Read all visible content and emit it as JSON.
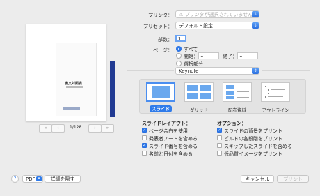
{
  "printer": {
    "label": "プリンタ：",
    "value": "プリンタが選択されていません",
    "icon": "warning-icon"
  },
  "preset": {
    "label": "プリセット：",
    "value": "デフォルト設定"
  },
  "copies": {
    "label": "部数：",
    "value": "1"
  },
  "pages": {
    "label": "ページ：",
    "all": "すべて",
    "from_label": "開始：",
    "from_value": "1",
    "to_label": "終了：",
    "to_value": "1",
    "selection": "選択部分"
  },
  "app_menu": {
    "value": "Keynote"
  },
  "preview": {
    "doc_title": "機文対照表",
    "page_counter": "1/128",
    "first": "«",
    "prev": "‹",
    "next": "›",
    "last": "»"
  },
  "layouts": [
    {
      "label": "スライド",
      "selected": true
    },
    {
      "label": "グリッド",
      "selected": false
    },
    {
      "label": "配布資料",
      "selected": false
    },
    {
      "label": "アウトライン",
      "selected": false
    }
  ],
  "slide_layout": {
    "title": "スライドレイアウト：",
    "options": [
      {
        "label": "ページ余白を使用",
        "checked": true
      },
      {
        "label": "発表者ノートを含める",
        "checked": false
      },
      {
        "label": "スライド番号を含める",
        "checked": true
      },
      {
        "label": "名前と日付を含める",
        "checked": false
      }
    ]
  },
  "options": {
    "title": "オプション：",
    "options": [
      {
        "label": "スライドの背景をプリント",
        "checked": true
      },
      {
        "label": "ビルドの各段階をプリント",
        "checked": false
      },
      {
        "label": "スキップしたスライドを含める",
        "checked": false
      },
      {
        "label": "低品質イメージをプリント",
        "checked": false
      }
    ]
  },
  "bottom": {
    "help": "?",
    "pdf": "PDF",
    "hide_details": "詳細を隠す",
    "cancel": "キャンセル",
    "print": "プリント"
  },
  "colors": {
    "accent": "#2f7bea",
    "doc_bar": "#213a92"
  }
}
